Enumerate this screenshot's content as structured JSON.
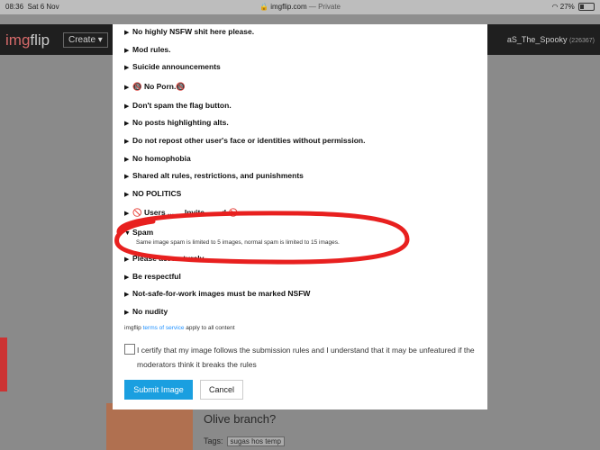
{
  "status_bar": {
    "time": "08:36",
    "date": "Sat 6 Nov",
    "url": "imgflip.com",
    "privacy": "— Private",
    "battery": "27%",
    "battery_level": 0.27
  },
  "header": {
    "logo_part1": "img",
    "logo_part2": "flip",
    "create_label": "Create ▾",
    "username": "aS_The_Spooky",
    "user_points": "(226367)"
  },
  "rules": [
    "No highly NSFW shit here please.",
    "Mod rules.",
    "Suicide announcements",
    "🔞 No Porn.🔞",
    "Don't spam the flag button.",
    "No posts highlighting alts.",
    "Do not repost other user's face or identities without permission.",
    "No homophobia",
    "Shared alt rules, restrictions, and punishments",
    "NO POLITICS",
    "🚫 Users ... ... Invite ... ...d 🚫",
    "Spam",
    "Please act maturely",
    "Be respectful",
    "Not-safe-for-work images must be marked NSFW",
    "No nudity"
  ],
  "spam_description": "Same image spam is limited to 5 images, normal spam is limited to 15 images.",
  "tos": {
    "prefix": "imgflip",
    "link": "terms of service",
    "suffix": "apply to all content"
  },
  "certify_text": "I certify that my image follows the submission rules and I understand that it may be unfeatured if the moderators think it breaks the rules",
  "buttons": {
    "submit": "Submit Image",
    "cancel": "Cancel"
  },
  "background_post": {
    "title": "Olive branch?",
    "tags_label": "Tags:",
    "tag": "sugas hos temp"
  }
}
